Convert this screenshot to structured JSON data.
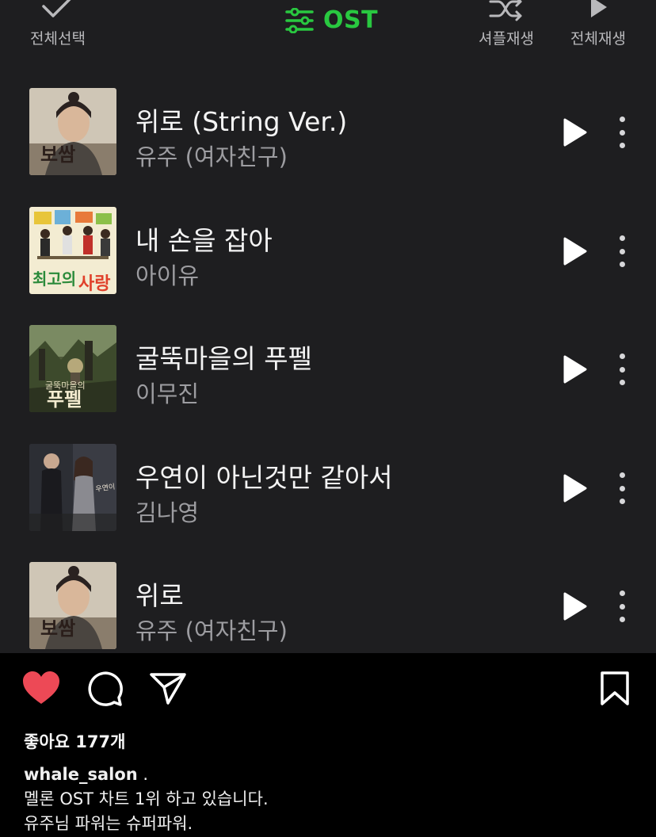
{
  "toolbar": {
    "select_all": "전체선택",
    "filter": "OST",
    "shuffle": "셔플재생",
    "play_all": "전체재생",
    "accent_color": "#29c840"
  },
  "tracks": [
    {
      "title": "위로 (String Ver.)",
      "artist": "유주 (여자친구)",
      "cover": "boksam-album-art"
    },
    {
      "title": "내 손을 잡아",
      "artist": "아이유",
      "cover": "best-love-album-art"
    },
    {
      "title": "굴뚝마을의 푸펠",
      "artist": "이무진",
      "cover": "poupelle-album-art"
    },
    {
      "title": "우연이 아닌것만 같아서",
      "artist": "김나영",
      "cover": "drama-ost-album-art"
    },
    {
      "title": "위로",
      "artist": "유주 (여자친구)",
      "cover": "boksam-album-art"
    }
  ],
  "post": {
    "likes": "좋아요 177개",
    "username": "whale_salon",
    "username_suffix": " .",
    "caption_line1": "멜론 OST 차트 1위 하고 있습니다.",
    "caption_line2": "유주님 파워는 슈퍼파워.",
    "like_color": "#ed4956"
  }
}
